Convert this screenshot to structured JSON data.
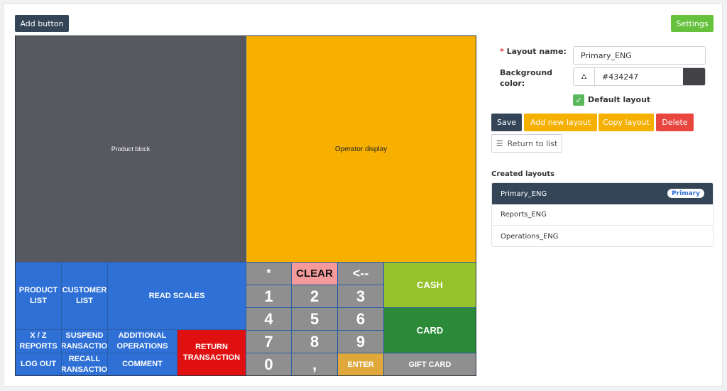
{
  "toolbar": {
    "add_button": "Add button",
    "settings_button": "Settings"
  },
  "layout": {
    "product_block": "Product block",
    "operator_display": "Operator display",
    "buttons": {
      "product_list": "PRODUCT LIST",
      "customer_list": "CUSTOMER LIST",
      "read_scales": "READ SCALES",
      "xz_reports": "X / Z REPORTS",
      "suspend_transaction": "SUSPEND TRANSACTION",
      "additional_operations": "ADDITIONAL OPERATIONS",
      "return_transaction": "RETURN TRANSACTION",
      "log_out": "LOG OUT",
      "recall_transaction": "RECALL TRANSACTION",
      "comment": "COMMENT",
      "asterisk": "*",
      "clear": "CLEAR",
      "backspace": "<--",
      "cash": "CASH",
      "card": "CARD",
      "gift_card": "GIFT CARD",
      "enter": "ENTER",
      "comma": ",",
      "n1": "1",
      "n2": "2",
      "n3": "3",
      "n4": "4",
      "n5": "5",
      "n6": "6",
      "n7": "7",
      "n8": "8",
      "n9": "9",
      "n0": "0"
    }
  },
  "form": {
    "required_mark": "*",
    "layout_name_label": "Layout name:",
    "layout_name_value": "Primary_ENG",
    "background_color_label": "Background color:",
    "background_color_value": "#434247",
    "default_layout_label": "Default layout",
    "default_layout_checked": true,
    "actions": {
      "save": "Save",
      "add_new": "Add new layout",
      "copy": "Copy layout",
      "delete": "Delete",
      "return": "Return to list"
    }
  },
  "created_layouts": {
    "title": "Created layouts",
    "items": [
      {
        "name": "Primary_ENG",
        "badge": "Primary",
        "active": true
      },
      {
        "name": "Reports_ENG"
      },
      {
        "name": "Operations_ENG"
      }
    ]
  },
  "colors": {
    "dark": "#344558",
    "green": "#66c13d",
    "product_block": "#575860",
    "operator_display": "#f8b000",
    "pos_blue": "#2e70d6",
    "pos_red": "#e01010",
    "pos_gray": "#8f8f8f",
    "cash": "#96c22a",
    "card": "#2a8a38",
    "clear": "#f59a9a",
    "enter": "#e0a73a",
    "copy": "#f5b000",
    "delete": "#e8463f"
  }
}
